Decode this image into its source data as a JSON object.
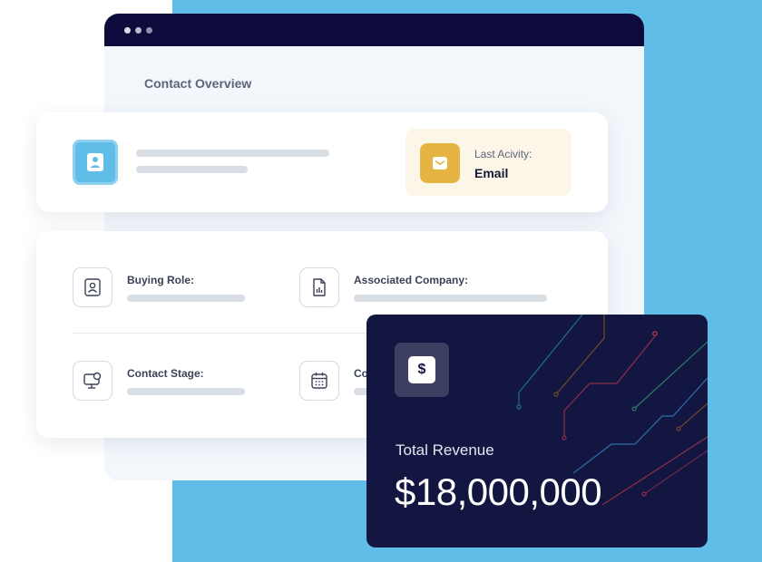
{
  "window": {
    "title": "Contact Overview"
  },
  "profile": {
    "last_activity_label": "Last Acivity:",
    "last_activity_value": "Email"
  },
  "fields": [
    {
      "label": "Buying Role:",
      "icon": "contact-card-icon"
    },
    {
      "label": "Associated Company:",
      "icon": "report-chart-icon"
    },
    {
      "label": "Contact Stage:",
      "icon": "monitor-chat-icon"
    },
    {
      "label": "Co",
      "icon": "calendar-icon"
    }
  ],
  "revenue": {
    "symbol": "$",
    "label": "Total Revenue",
    "value": "$18,000,000"
  },
  "colors": {
    "accent_blue": "#5fbde8",
    "navy": "#0c0b3b",
    "revenue_bg": "#131640",
    "activity_gold": "#e6b443"
  }
}
